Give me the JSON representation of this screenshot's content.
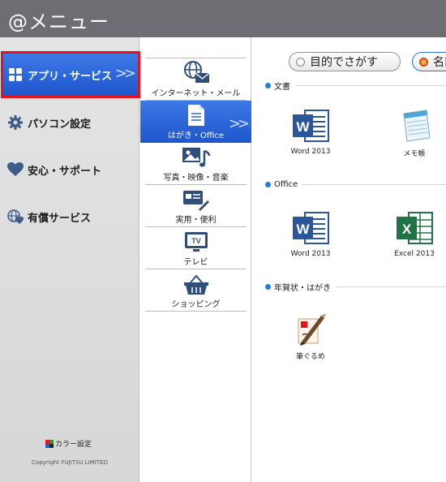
{
  "window": {
    "title": "@メニュー"
  },
  "categories": [
    {
      "label": "アプリ・サービス",
      "icon": "apps-grid-icon",
      "selected": true
    },
    {
      "label": "パソコン設定",
      "icon": "gear-icon",
      "selected": false
    },
    {
      "label": "安心・サポート",
      "icon": "heart-icon",
      "selected": false
    },
    {
      "label": "有償サービス",
      "icon": "globe-heart-icon",
      "selected": false
    }
  ],
  "footer": {
    "color_setting": "カラー設定",
    "copyright": "Copyright FUJITSU LIMITED"
  },
  "subcategories": [
    {
      "label": "インターネット・メール",
      "icon": "globe-mail-icon",
      "selected": false
    },
    {
      "label": "はがき・Office",
      "icon": "document-icon",
      "selected": true
    },
    {
      "label": "写真・映像・音楽",
      "icon": "photo-music-icon",
      "selected": false
    },
    {
      "label": "実用・便利",
      "icon": "card-pen-icon",
      "selected": false
    },
    {
      "label": "テレビ",
      "icon": "tv-icon",
      "selected": false
    },
    {
      "label": "ショッピング",
      "icon": "basket-icon",
      "selected": false
    }
  ],
  "search_modes": [
    {
      "label": "目的でさがす",
      "selected": false
    },
    {
      "label": "名前でさがす",
      "selected": true
    }
  ],
  "sections": [
    {
      "title": "文書",
      "apps": [
        {
          "label": "Word 2013",
          "icon": "word-icon"
        },
        {
          "label": "メモ帳",
          "icon": "notepad-icon"
        }
      ]
    },
    {
      "title": "Office",
      "apps": [
        {
          "label": "Word 2013",
          "icon": "word-icon"
        },
        {
          "label": "Excel 2013",
          "icon": "excel-icon"
        }
      ]
    },
    {
      "title": "年賀状・はがき",
      "apps": [
        {
          "label": "筆ぐるめ",
          "icon": "fudegurume-icon"
        }
      ]
    }
  ],
  "colors": {
    "titlebar": "#6d6d73",
    "selected_blue": "#2d65d8",
    "highlight_border": "#e8121b",
    "word_blue": "#2b579a",
    "excel_green": "#217346",
    "section_dot": "#1e7fe0"
  }
}
